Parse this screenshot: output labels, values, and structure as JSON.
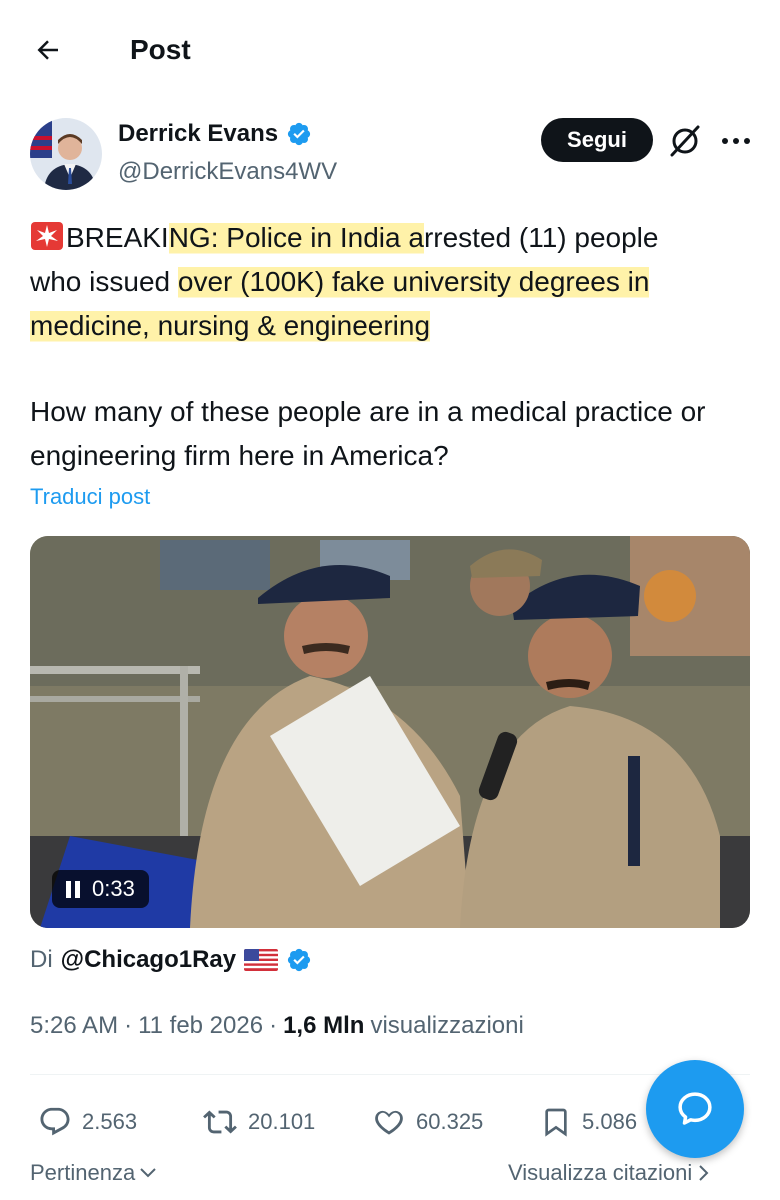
{
  "header": {
    "title": "Post"
  },
  "author": {
    "name": "Derrick Evans",
    "handle": "@DerrickEvans4WV",
    "follow_label": "Segui"
  },
  "tweet": {
    "line1_prefix": "BREAKI",
    "line1_highlight": "NG: Police in India a",
    "line1_suffix": "rrested (11) people",
    "line2_prefix": "who issued ",
    "line2_highlight": "over (100K) fake university degrees in",
    "line3_highlight": "medicine, nursing & engineering",
    "paragraph2": "How many of these people are in a medical practice or engineering firm here in America?",
    "translate_label": "Traduci post"
  },
  "video": {
    "time": "0:33"
  },
  "attribution": {
    "prefix": "Di",
    "source": "@Chicago1Ray"
  },
  "meta": {
    "time": "5:26 AM",
    "date": "11 feb 2026",
    "views_value": "1,6 Mln",
    "views_label": "visualizzazioni",
    "separator": "·"
  },
  "actions": {
    "replies": "2.563",
    "reposts": "20.101",
    "likes": "60.325",
    "bookmarks": "5.086"
  },
  "footer": {
    "sort_label": "Pertinenza",
    "quotes_label": "Visualizza citazioni"
  },
  "colors": {
    "accent": "#1d9bf0",
    "text": "#0f1419",
    "secondary": "#536471",
    "highlight": "#ffed8c"
  }
}
